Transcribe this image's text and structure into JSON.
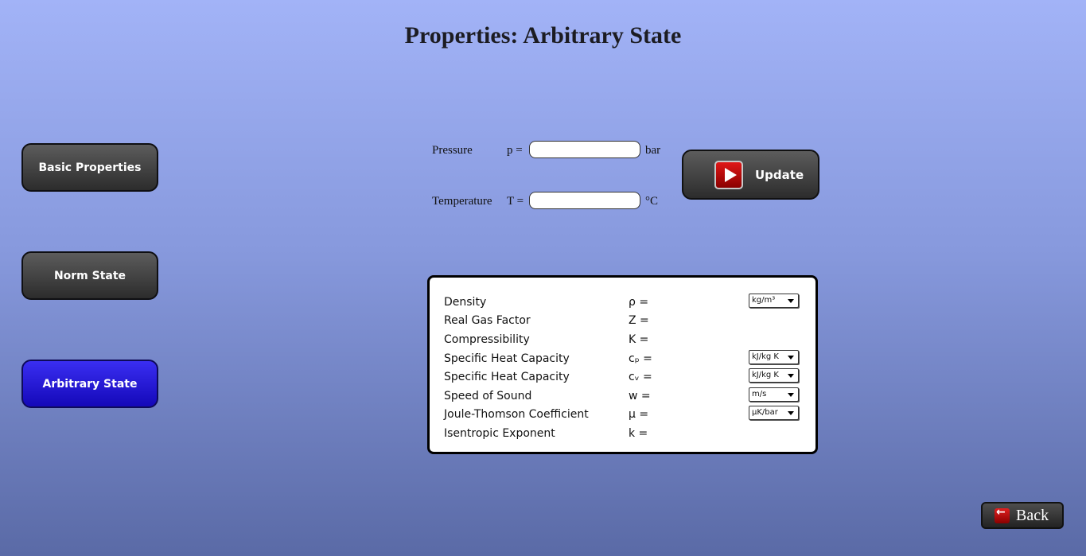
{
  "title": "Properties: Arbitrary State",
  "nav": [
    {
      "label": "Basic Properties"
    },
    {
      "label": "Norm State"
    },
    {
      "label": "Arbitrary State"
    }
  ],
  "inputs": {
    "pressure": {
      "label": "Pressure",
      "symbol": "p =",
      "value": "",
      "unit": "bar"
    },
    "temperature": {
      "label": "Temperature",
      "symbol": "T =",
      "value": "",
      "unit": "°C"
    }
  },
  "update_label": "Update",
  "results": [
    {
      "name": "Density",
      "symbol": "ρ =",
      "unit": "kg/m³"
    },
    {
      "name": "Real Gas Factor",
      "symbol": "Z =",
      "unit": ""
    },
    {
      "name": "Compressibility",
      "symbol": "K =",
      "unit": ""
    },
    {
      "name": "Specific Heat Capacity",
      "symbol": "cₚ =",
      "unit": "kJ/kg K"
    },
    {
      "name": "Specific Heat Capacity",
      "symbol": "cᵥ =",
      "unit": "kJ/kg K"
    },
    {
      "name": "Speed of Sound",
      "symbol": "w =",
      "unit": "m/s"
    },
    {
      "name": "Joule-Thomson Coefficient",
      "symbol": "μ =",
      "unit": "μK/bar"
    },
    {
      "name": "Isentropic Exponent",
      "symbol": "k =",
      "unit": ""
    }
  ],
  "back_label": "Back"
}
